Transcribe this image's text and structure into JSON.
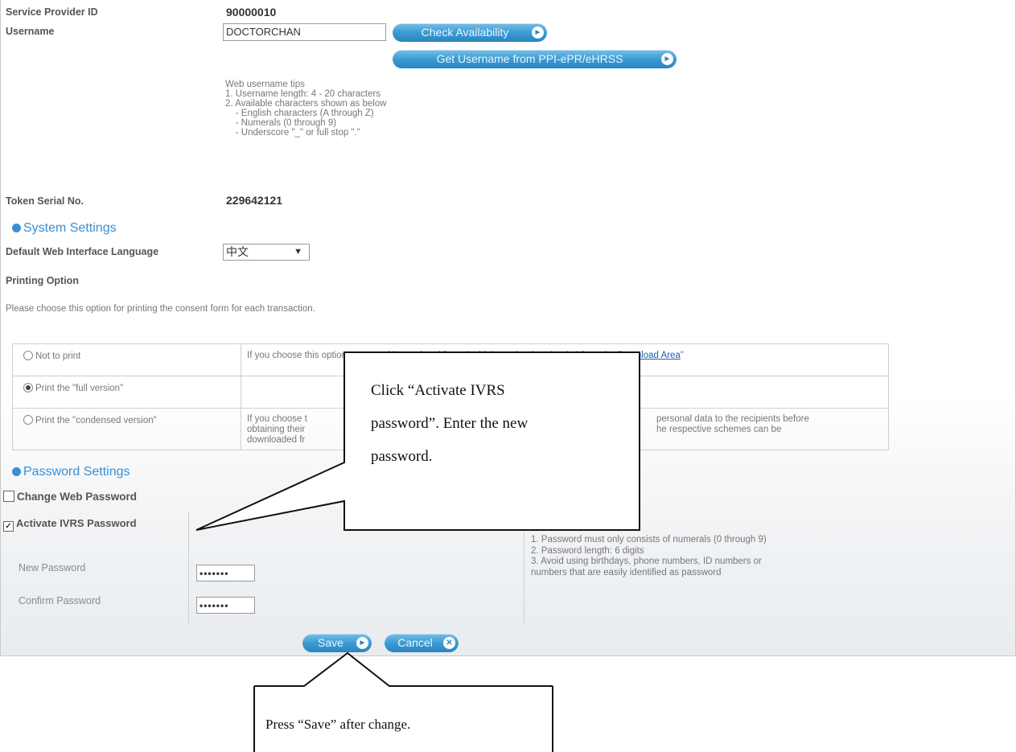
{
  "account": {
    "sp_id_label": "Service Provider ID",
    "sp_id_value": "90000010",
    "username_label": "Username",
    "username_value": "DOCTORCHAN",
    "check_availability_label": "Check Availability",
    "get_username_label": "Get Username from PPI-ePR/eHRSS",
    "tips": "Web username tips\n1. Username length: 4 - 20 characters\n2. Available characters shown as below\n    - English characters (A through Z)\n    - Numerals (0 through 9)\n    - Underscore \"_\" or full stop \".\"",
    "token_label": "Token Serial No.",
    "token_value": "229642121"
  },
  "system_settings": {
    "title": "System Settings",
    "language_label": "Default Web Interface Language",
    "language_value": "中文",
    "printing_label": "Printing Option",
    "printing_prompt": "Please choose this option for printing the consent form for each transaction.",
    "options": [
      {
        "label": "Not to print",
        "selected": false,
        "desc": "If you choose this option, you need \"pre-printed forms\" which can be downloaded from the ",
        "link": "Download Area",
        "link_suffix": "\""
      },
      {
        "label": "Print the \"full version\"",
        "selected": true,
        "desc": ""
      },
      {
        "label": "Print the \"condensed version\"",
        "selected": false,
        "desc_line1": "If you choose t",
        "desc_line2": "obtaining their",
        "desc_line3": "downloaded fr",
        "desc_right1": "personal data to the recipients before",
        "desc_right2": "he respective schemes can be"
      }
    ]
  },
  "password_settings": {
    "title": "Password Settings",
    "change_web_label": "Change Web Password",
    "activate_ivrs_label": "Activate IVRS Password",
    "new_password_label": "New Password",
    "confirm_password_label": "Confirm Password",
    "new_password_value": "•••••••",
    "confirm_password_value": "•••••••",
    "tips_fragment": "s",
    "tips": "1. Password must only consists of numerals (0 through 9)\n2. Password length: 6 digits\n3. Avoid using birthdays, phone numbers, ID numbers or\nnumbers that are easily identified as password"
  },
  "actions": {
    "save_label": "Save",
    "cancel_label": "Cancel"
  },
  "callouts": {
    "activate_line1": "Click “Activate IVRS",
    "activate_line2": "password”. Enter the new",
    "activate_line3": "password.",
    "save_note": "Press “Save” after change."
  },
  "colors": {
    "accent": "#3a8fd6",
    "button": "#3c9bd3",
    "link": "#1a5fb4"
  }
}
